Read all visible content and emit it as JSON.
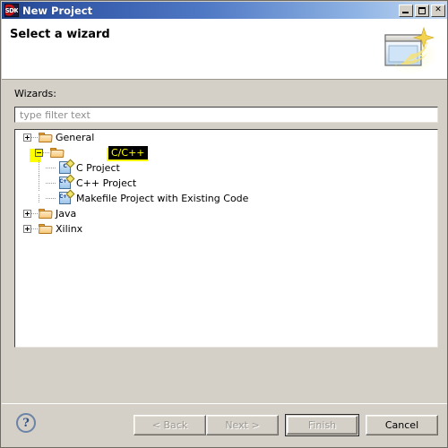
{
  "window": {
    "title": "New Project",
    "icon": "sdk-icon",
    "controls": [
      {
        "name": "minimize",
        "glyph": "_"
      },
      {
        "name": "maximize",
        "glyph": "□"
      },
      {
        "name": "close",
        "glyph": "✕"
      }
    ]
  },
  "header": {
    "title": "Select a wizard",
    "banner_icon": "wizard-window-sparkle-icon"
  },
  "form": {
    "wizards_label": "Wizards:",
    "filter_placeholder": "type filter text",
    "filter_value": ""
  },
  "tree": {
    "items": [
      {
        "label": "General",
        "level": 0,
        "expander": "plus",
        "icon": "folder-icon",
        "selected": false,
        "highlighted": false
      },
      {
        "label": "C/C++",
        "level": 0,
        "expander": "minus",
        "icon": "folder-icon",
        "selected": true,
        "highlighted": true
      },
      {
        "label": "C Project",
        "level": 1,
        "expander": "none",
        "icon": "c-project-icon",
        "icon_text": "C",
        "selected": false,
        "highlighted": false
      },
      {
        "label": "C++ Project",
        "level": 1,
        "expander": "none",
        "icon": "cpp-project-icon",
        "icon_text": "C++",
        "selected": false,
        "highlighted": false
      },
      {
        "label": "Makefile Project with Existing Code",
        "level": 1,
        "expander": "none",
        "icon": "makefile-project-icon",
        "icon_text": "C++",
        "selected": false,
        "highlighted": false
      },
      {
        "label": "Java",
        "level": 0,
        "expander": "plus",
        "icon": "folder-icon",
        "selected": false,
        "highlighted": false
      },
      {
        "label": "Xilinx",
        "level": 0,
        "expander": "plus",
        "icon": "folder-icon",
        "selected": false,
        "highlighted": false
      }
    ]
  },
  "footer": {
    "help_glyph": "?",
    "buttons": [
      {
        "label": "< Back",
        "name": "back-button",
        "enabled": false,
        "default": false
      },
      {
        "label": "Next >",
        "name": "next-button",
        "enabled": false,
        "default": false
      },
      {
        "label": "Finish",
        "name": "finish-button",
        "enabled": false,
        "default": true
      },
      {
        "label": "Cancel",
        "name": "cancel-button",
        "enabled": true,
        "default": false
      }
    ]
  },
  "colors": {
    "titlebar_start": "#1d3e81",
    "titlebar_end": "#c8d9f2",
    "dialog_bg": "#d4d0c8",
    "highlight": "#ffff00",
    "selection_bg": "#000000",
    "selection_fg": "#ffff00"
  }
}
